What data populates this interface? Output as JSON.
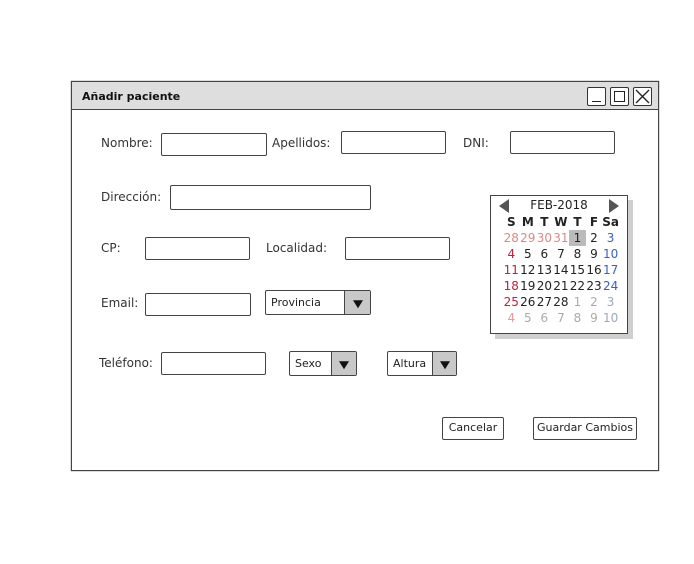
{
  "window": {
    "title": "Añadir paciente"
  },
  "form": {
    "nombre_label": "Nombre:",
    "apellidos_label": "Apellidos:",
    "dni_label": "DNI:",
    "direccion_label": "Dirección:",
    "cp_label": "CP:",
    "localidad_label": "Localidad:",
    "email_label": "Email:",
    "provincia_value": "Provincia",
    "telefono_label": "Teléfono:",
    "sexo_value": "Sexo",
    "altura_value": "Altura"
  },
  "buttons": {
    "cancel": "Cancelar",
    "save": "Guardar Cambios"
  },
  "calendar": {
    "month": "FEB-2018",
    "headers": [
      "S",
      "M",
      "T",
      "W",
      "T",
      "F",
      "Sa"
    ],
    "weeks": [
      [
        "28",
        "29",
        "30",
        "31",
        "1",
        "2",
        "3"
      ],
      [
        "4",
        "5",
        "6",
        "7",
        "8",
        "9",
        "10"
      ],
      [
        "11",
        "12",
        "13",
        "14",
        "15",
        "16",
        "17"
      ],
      [
        "18",
        "19",
        "20",
        "21",
        "22",
        "23",
        "24"
      ],
      [
        "25",
        "26",
        "27",
        "28",
        "1",
        "2",
        "3"
      ],
      [
        "4",
        "5",
        "6",
        "7",
        "8",
        "9",
        "10"
      ]
    ],
    "selected": "1"
  }
}
